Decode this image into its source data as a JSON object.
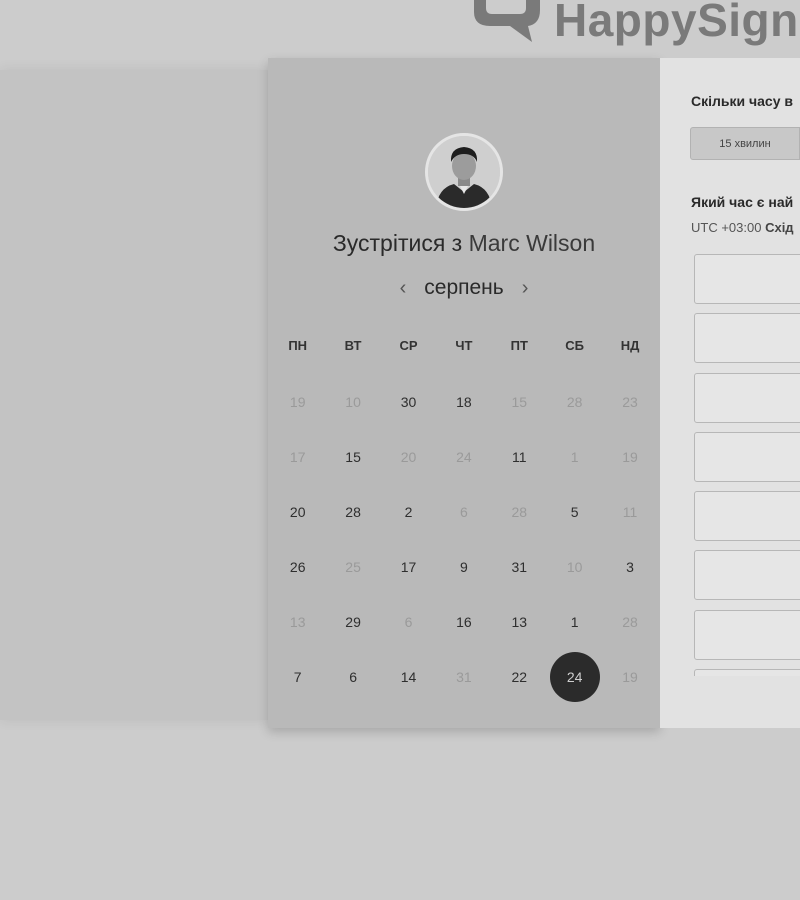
{
  "brand": {
    "name": "HappySigna"
  },
  "calendar": {
    "meet_prefix": "Зустрітися з",
    "host_name": "Marc Wilson",
    "month": "серпень",
    "prev_arrow": "‹",
    "next_arrow": "›",
    "weekdays": [
      "ПН",
      "ВТ",
      "СР",
      "ЧТ",
      "ПТ",
      "СБ",
      "НД"
    ],
    "weeks": [
      [
        {
          "d": "19",
          "available": false
        },
        {
          "d": "10",
          "available": false
        },
        {
          "d": "30",
          "available": true
        },
        {
          "d": "18",
          "available": true
        },
        {
          "d": "15",
          "available": false
        },
        {
          "d": "28",
          "available": false
        },
        {
          "d": "23",
          "available": false
        }
      ],
      [
        {
          "d": "17",
          "available": false
        },
        {
          "d": "15",
          "available": true
        },
        {
          "d": "20",
          "available": false
        },
        {
          "d": "24",
          "available": false
        },
        {
          "d": "11",
          "available": true
        },
        {
          "d": "1",
          "available": false
        },
        {
          "d": "19",
          "available": false
        }
      ],
      [
        {
          "d": "20",
          "available": true
        },
        {
          "d": "28",
          "available": true
        },
        {
          "d": "2",
          "available": true
        },
        {
          "d": "6",
          "available": false
        },
        {
          "d": "28",
          "available": false
        },
        {
          "d": "5",
          "available": true
        },
        {
          "d": "11",
          "available": false
        }
      ],
      [
        {
          "d": "26",
          "available": true
        },
        {
          "d": "25",
          "available": false
        },
        {
          "d": "17",
          "available": true
        },
        {
          "d": "9",
          "available": true
        },
        {
          "d": "31",
          "available": true
        },
        {
          "d": "10",
          "available": false
        },
        {
          "d": "3",
          "available": true
        }
      ],
      [
        {
          "d": "13",
          "available": false
        },
        {
          "d": "29",
          "available": true
        },
        {
          "d": "6",
          "available": false
        },
        {
          "d": "16",
          "available": true
        },
        {
          "d": "13",
          "available": true
        },
        {
          "d": "1",
          "available": true
        },
        {
          "d": "28",
          "available": false
        }
      ],
      [
        {
          "d": "7",
          "available": true
        },
        {
          "d": "6",
          "available": true
        },
        {
          "d": "14",
          "available": true
        },
        {
          "d": "31",
          "available": false
        },
        {
          "d": "22",
          "available": true
        },
        {
          "d": "24",
          "available": true,
          "selected": true
        },
        {
          "d": "19",
          "available": false
        }
      ]
    ]
  },
  "booking": {
    "duration_question": "Скільки часу в",
    "duration_options": [
      "15 хвилин"
    ],
    "time_question": "Який час є най",
    "tz_offset": "UTC +03:00",
    "tz_name": "Схід",
    "slot_count": 8
  },
  "colors": {
    "selected_day_bg": "#2b2b2b",
    "muted_day": "#9a9a9a"
  }
}
